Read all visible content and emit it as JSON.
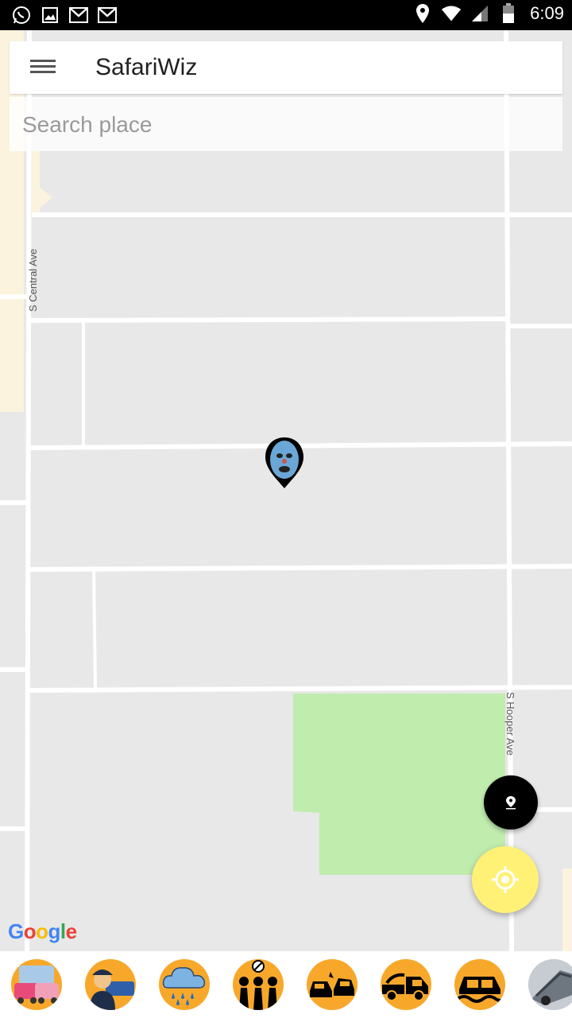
{
  "status_bar": {
    "time": "6:09",
    "left_icons": [
      "whatsapp-icon",
      "image-icon",
      "gmail-icon",
      "gmail-icon"
    ],
    "right_icons": [
      "location-icon",
      "wifi-icon",
      "signal-icon",
      "battery-icon"
    ]
  },
  "app_bar": {
    "title": "SafariWiz",
    "menu_icon": "hamburger-menu-icon"
  },
  "search": {
    "placeholder": "Search place",
    "value": ""
  },
  "map": {
    "streets": {
      "central": "S Central Ave",
      "hooper": "S Hooper Ave"
    },
    "attribution": [
      "G",
      "o",
      "o",
      "g",
      "l",
      "e"
    ],
    "attribution_colors": [
      "#4285F4",
      "#EA4335",
      "#FBBC05",
      "#4285F4",
      "#34A853",
      "#EA4335"
    ]
  },
  "fab": {
    "marker_icon": "map-pin-icon",
    "locate_icon": "my-location-icon"
  },
  "categories": [
    {
      "name": "traffic-jam-icon"
    },
    {
      "name": "police-icon"
    },
    {
      "name": "rain-icon"
    },
    {
      "name": "protest-icon"
    },
    {
      "name": "accident-icon"
    },
    {
      "name": "tow-truck-icon"
    },
    {
      "name": "flooded-car-icon"
    },
    {
      "name": "breakdown-icon"
    }
  ],
  "colors": {
    "accent": "#f7a82b",
    "locate_fab": "#fff176",
    "park": "#c0ecae"
  }
}
